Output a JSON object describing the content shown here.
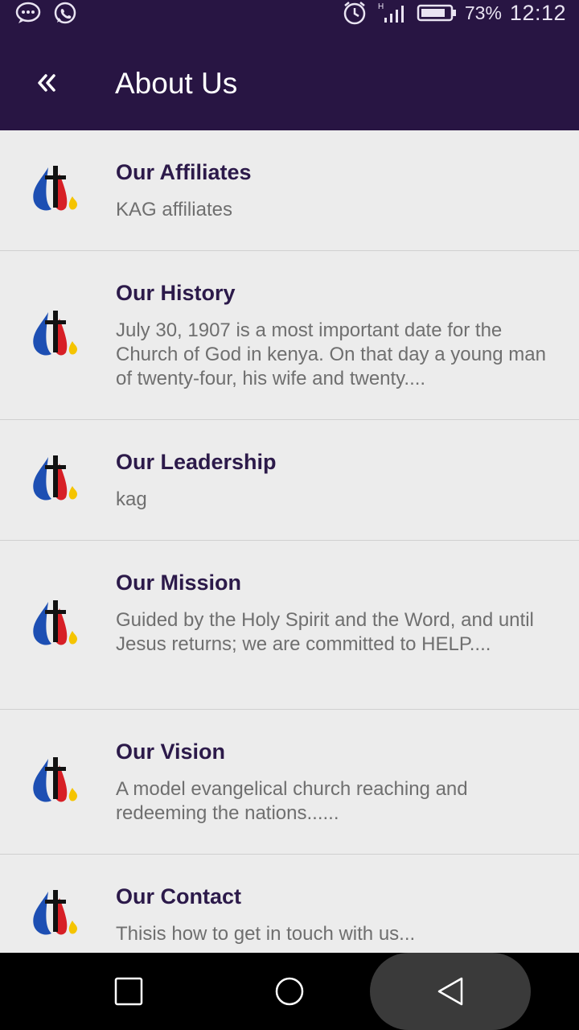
{
  "status_bar": {
    "battery_percent": "73%",
    "time": "12:12",
    "icons": [
      "message-icon",
      "whatsapp-icon",
      "alarm-icon",
      "signal-icon",
      "battery-icon"
    ]
  },
  "app_bar": {
    "title": "About Us",
    "back_icon": "double-chevron-left-icon"
  },
  "items": [
    {
      "title": "Our Affiliates",
      "desc": "KAG affiliates"
    },
    {
      "title": "Our History",
      "desc": "July 30, 1907 is a most important date for the Church of God in kenya. On that day a young man of twenty-four, his wife and twenty...."
    },
    {
      "title": "Our Leadership",
      "desc": "kag"
    },
    {
      "title": "Our Mission",
      "desc": "Guided by the Holy Spirit and the Word, and until Jesus returns; we are committed to HELP...."
    },
    {
      "title": "Our Vision",
      "desc": "A model evangelical church reaching and redeeming the nations......"
    },
    {
      "title": "Our Contact",
      "desc": "Thisis how to get in touch with us..."
    }
  ],
  "nav_bar": {
    "icons": [
      "recents-square-icon",
      "home-circle-icon",
      "back-triangle-icon"
    ]
  },
  "colors": {
    "primary": "#281543",
    "title_text": "#2c1a4a",
    "body_text": "#6f6f6f",
    "background": "#ececec",
    "logo_blue": "#1d4fb3",
    "logo_red": "#d71f26",
    "logo_yellow": "#f5c400"
  }
}
